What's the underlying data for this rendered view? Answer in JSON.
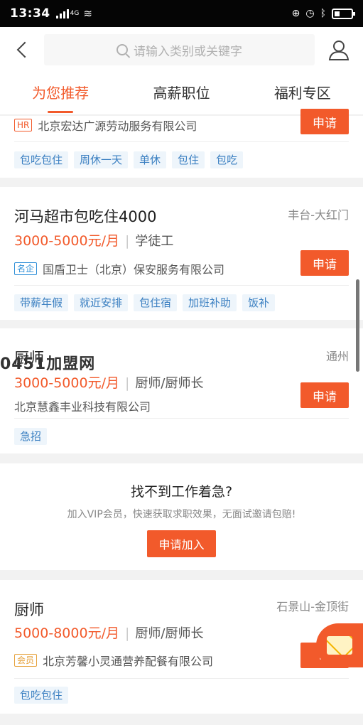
{
  "status_bar": {
    "time": "13:34",
    "network": "4G"
  },
  "search": {
    "placeholder": "请输入类别或关键字"
  },
  "tabs": [
    {
      "label": "为您推荐",
      "active": true
    },
    {
      "label": "高薪职位",
      "active": false
    },
    {
      "label": "福利专区",
      "active": false
    }
  ],
  "jobs": [
    {
      "company_badge": "HR",
      "company": "北京宏达广源劳动服务有限公司",
      "apply_label": "申请",
      "tags": [
        "包吃包住",
        "周休一天",
        "单休",
        "包住",
        "包吃"
      ]
    },
    {
      "title": "河马超市包吃住4000",
      "location": "丰台-大红门",
      "salary": "3000-5000元/月",
      "category": "学徒工",
      "company_badge": "名企",
      "company": "国盾卫士（北京）保安服务有限公司",
      "apply_label": "申请",
      "tags": [
        "带薪年假",
        "就近安排",
        "包住宿",
        "加班补助",
        "饭补"
      ]
    },
    {
      "title": "厨师",
      "location": "通州",
      "salary": "3000-5000元/月",
      "category": "厨师/厨师长",
      "company": "北京慧鑫丰业科技有限公司",
      "apply_label": "申请",
      "tags": [
        "急招"
      ]
    },
    {
      "title": "厨师",
      "location": "石景山-金顶街",
      "salary": "5000-8000元/月",
      "category": "厨师/厨师长",
      "company_badge": "会员",
      "company": "北京芳馨小灵通营养配餐有限公司",
      "apply_label": "申",
      "tags": [
        "包吃包住"
      ]
    }
  ],
  "promo": {
    "heading": "找不到工作着急?",
    "subtext": "加入VIP会员，快速获取求职效果，无面试邀请包赔!",
    "button": "申请加入"
  },
  "watermark": "0451加盟网",
  "colors": {
    "accent": "#f25a2b",
    "tag_bg": "#eef5fb",
    "tag_text": "#3a7fc1"
  }
}
